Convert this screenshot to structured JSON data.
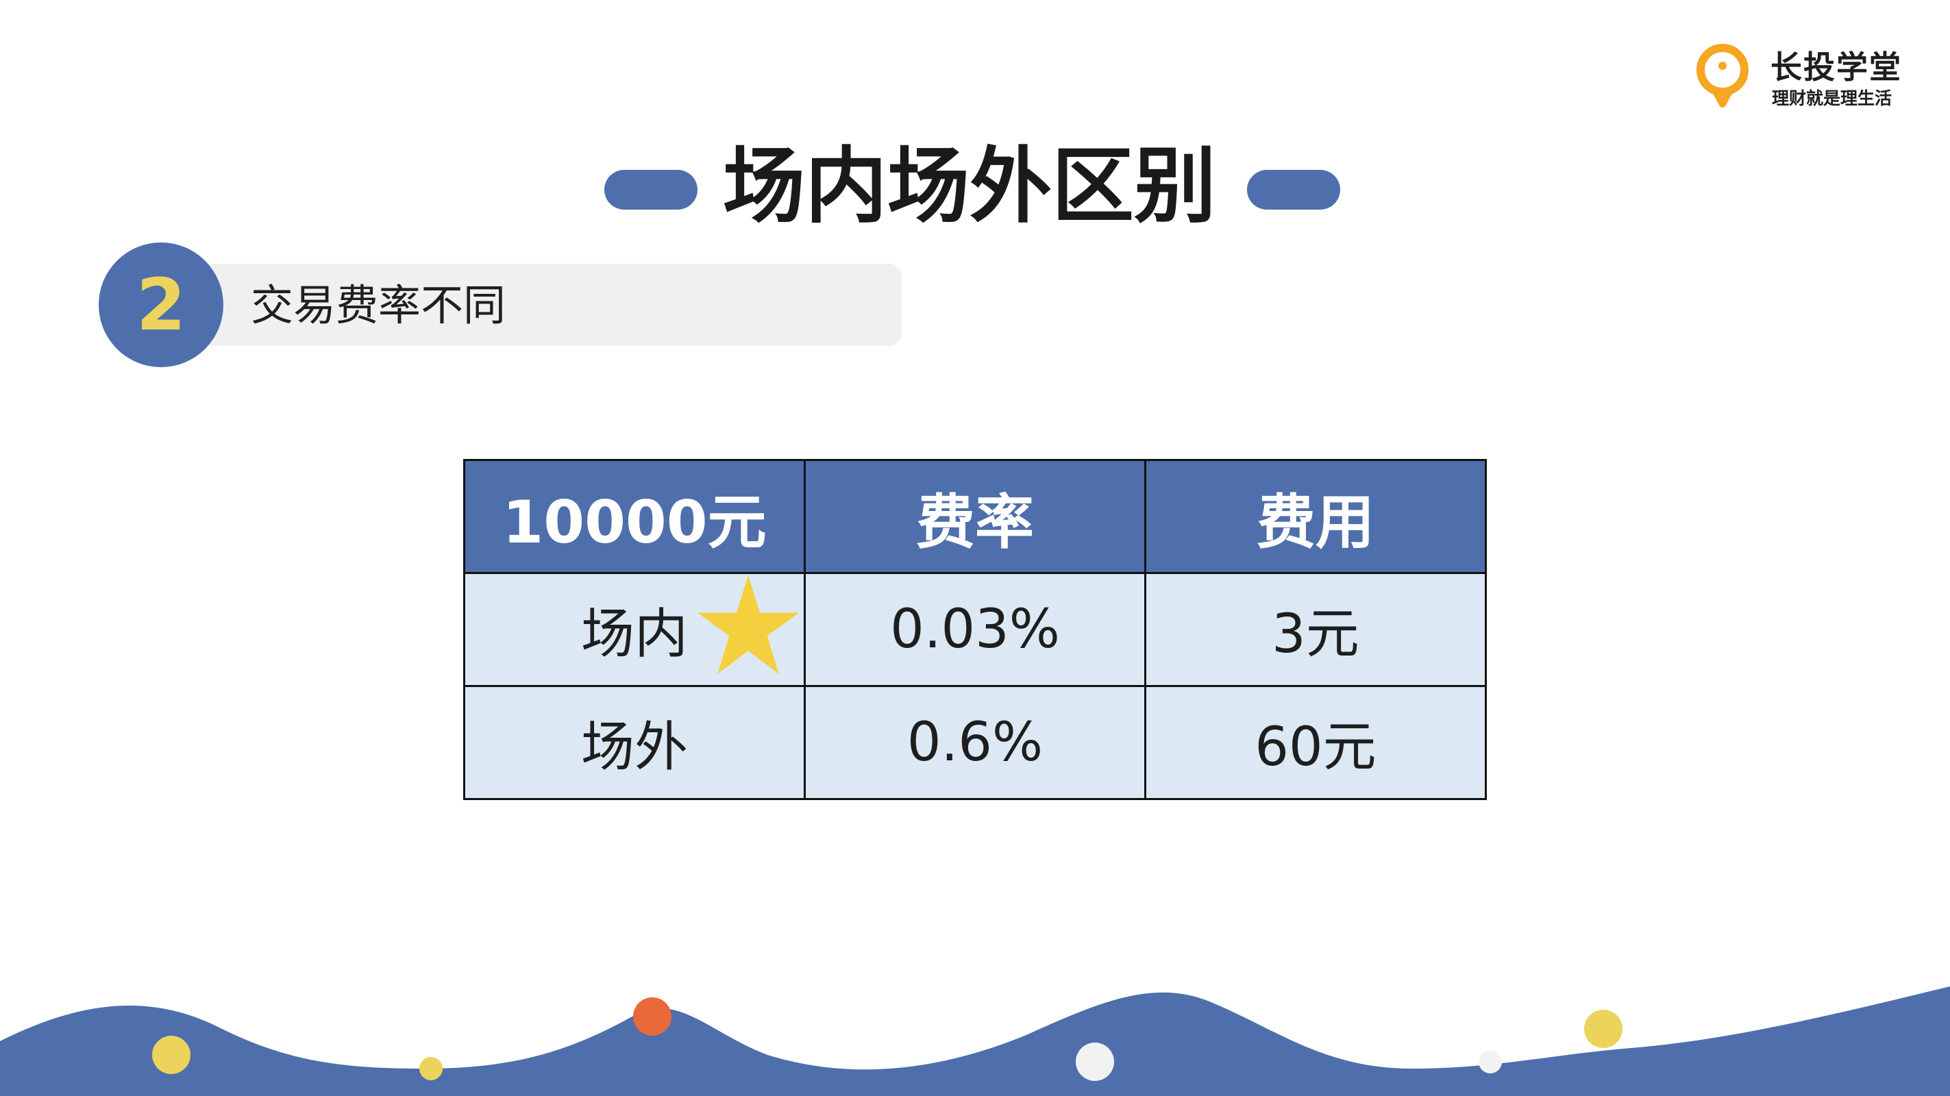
{
  "logo": {
    "name": "长投学堂",
    "slogan": "理财就是理生活",
    "icon": "lightbulb-icon",
    "color": "#f5a623"
  },
  "title": "场内场外区别",
  "section": {
    "number": "2",
    "label": "交易费率不同"
  },
  "table": {
    "headers": [
      "10000元",
      "费率",
      "费用"
    ],
    "rows": [
      [
        "场内",
        "0.03%",
        "3元"
      ],
      [
        "场外",
        "0.6%",
        "60元"
      ]
    ],
    "highlighted_row_icon": "star-icon"
  },
  "colors": {
    "primary": "#4e6fab",
    "accent_yellow": "#ecd35c",
    "star": "#f4d03f",
    "row_bg": "#dde8f5",
    "dot_orange": "#e8693a",
    "dot_yellow": "#ecd35c",
    "dot_white": "#f2f2f2"
  }
}
